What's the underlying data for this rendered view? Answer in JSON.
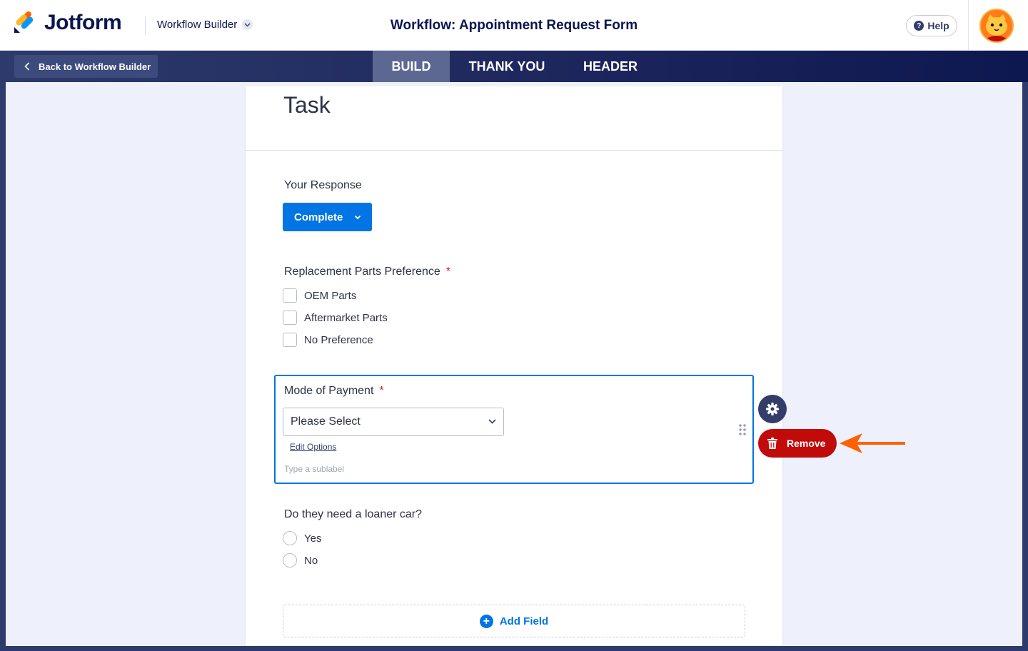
{
  "header": {
    "brand": "Jotform",
    "workflow_menu": "Workflow Builder",
    "title": "Workflow: Appointment Request Form",
    "help": "Help"
  },
  "nav": {
    "back": "Back to Workflow Builder",
    "tabs": [
      {
        "label": "BUILD",
        "active": true
      },
      {
        "label": "THANK YOU",
        "active": false
      },
      {
        "label": "HEADER",
        "active": false
      }
    ]
  },
  "form": {
    "title": "Task",
    "response": {
      "label": "Your Response",
      "value": "Complete"
    },
    "parts": {
      "label": "Replacement Parts Preference",
      "required": "*",
      "options": [
        "OEM Parts",
        "Aftermarket Parts",
        "No Preference"
      ]
    },
    "payment": {
      "label": "Mode of Payment",
      "required": "*",
      "placeholder": "Please Select",
      "edit_options": "Edit Options",
      "sublabel": "Type a sublabel"
    },
    "loaner": {
      "label": "Do they need a loaner car?",
      "options": [
        "Yes",
        "No"
      ]
    },
    "add_field": "Add Field"
  },
  "actions": {
    "remove": "Remove"
  },
  "colors": {
    "accent": "#0075e3",
    "navy": "#0a1551",
    "danger": "#c10b0b",
    "arrow": "#ff6100"
  }
}
